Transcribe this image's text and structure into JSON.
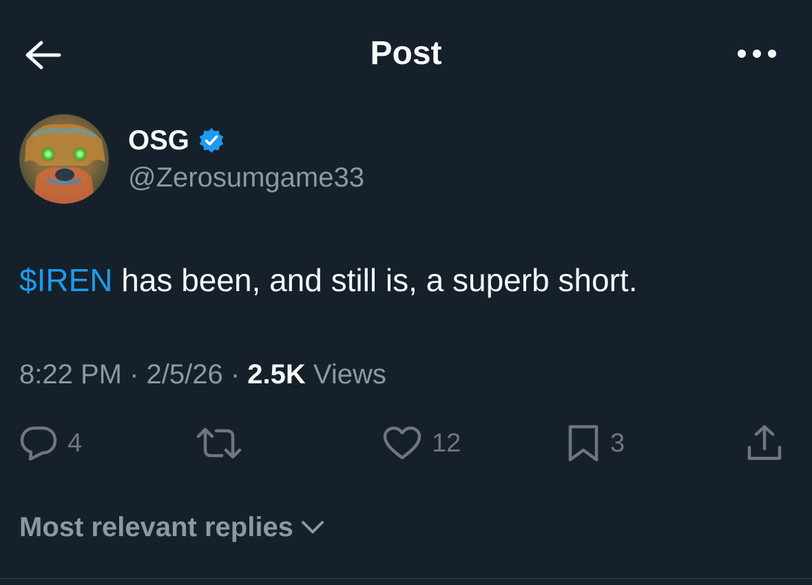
{
  "header": {
    "title": "Post",
    "back_icon": "arrow-left-icon",
    "more_icon": "more-horizontal-icon"
  },
  "author": {
    "name": "OSG",
    "handle": "@Zerosumgame33",
    "verified": true,
    "verified_color": "#1d9bf0",
    "avatar_icon": "avatar-image"
  },
  "tweet": {
    "cashtag": "$IREN",
    "text": " has been, and still is, a superb short."
  },
  "meta": {
    "time": "8:22 PM",
    "sep1": " · ",
    "date": "2/5/26",
    "sep2": " · ",
    "views_count": "2.5K",
    "views_label": " Views"
  },
  "actions": {
    "replies": "4",
    "reposts": "",
    "likes": "12",
    "bookmarks": "3"
  },
  "replies": {
    "sort_label": "Most relevant replies"
  },
  "colors": {
    "background": "#15202b",
    "accent": "#1d9bf0",
    "text_primary": "#f7f9f9",
    "text_secondary": "#8b98a5",
    "icon_muted": "#71767b"
  }
}
